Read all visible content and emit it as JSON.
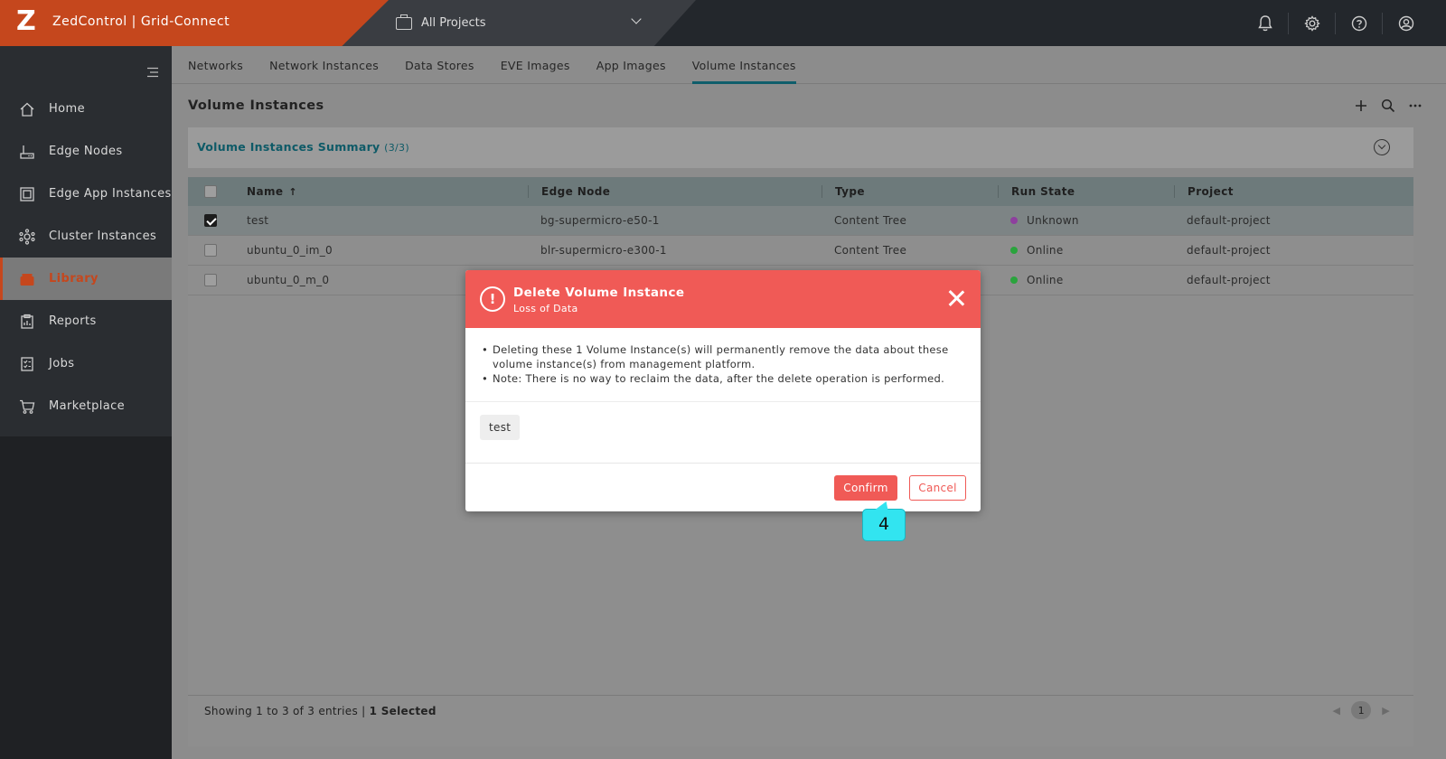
{
  "header": {
    "logo_letter": "Z",
    "app_title": "ZedControl | Grid-Connect",
    "project_selector": "All Projects",
    "icons": [
      "bell-icon",
      "gear-icon",
      "help-icon",
      "user-icon"
    ]
  },
  "sidebar": {
    "items": [
      {
        "label": "Home",
        "icon": "home-icon"
      },
      {
        "label": "Edge Nodes",
        "icon": "edge-node-icon"
      },
      {
        "label": "Edge App Instances",
        "icon": "app-instance-icon"
      },
      {
        "label": "Cluster Instances",
        "icon": "cluster-icon"
      },
      {
        "label": "Library",
        "icon": "library-icon",
        "active": true
      },
      {
        "label": "Reports",
        "icon": "reports-icon"
      },
      {
        "label": "Jobs",
        "icon": "jobs-icon"
      },
      {
        "label": "Marketplace",
        "icon": "cart-icon"
      }
    ]
  },
  "tabs": [
    {
      "label": "Networks"
    },
    {
      "label": "Network Instances"
    },
    {
      "label": "Data Stores"
    },
    {
      "label": "EVE Images"
    },
    {
      "label": "App Images"
    },
    {
      "label": "Volume Instances",
      "active": true
    }
  ],
  "page": {
    "title": "Volume Instances",
    "summary_title": "Volume Instances Summary",
    "summary_count": "(3/3)"
  },
  "table": {
    "columns": [
      "Name",
      "Edge Node",
      "Type",
      "Run State",
      "Project"
    ],
    "rows": [
      {
        "name": "test",
        "edge_node": "bg-supermicro-e50-1",
        "type": "Content Tree",
        "run_state": "Unknown",
        "state_color": "#8e3f9e",
        "project": "default-project",
        "checked": true
      },
      {
        "name": "ubuntu_0_im_0",
        "edge_node": "blr-supermicro-e300-1",
        "type": "Content Tree",
        "run_state": "Online",
        "state_color": "#2aa43d",
        "project": "default-project",
        "checked": false
      },
      {
        "name": "ubuntu_0_m_0",
        "edge_node": "",
        "type": "",
        "run_state": "Online",
        "state_color": "#2aa43d",
        "project": "default-project",
        "checked": false
      }
    ]
  },
  "footer": {
    "showing": "Showing 1 to 3 of 3 entries | ",
    "selected": "1 Selected",
    "page": "1"
  },
  "modal": {
    "title": "Delete Volume Instance",
    "subtitle": "Loss of Data",
    "alert_symbol": "!",
    "bullets": [
      "Deleting these 1 Volume Instance(s) will permanently remove the data about these volume instance(s) from management platform.",
      "Note: There is no way to reclaim the data, after the delete operation is performed."
    ],
    "chip": "test",
    "confirm_label": "Confirm",
    "cancel_label": "Cancel"
  },
  "callout": {
    "step": "4"
  },
  "colors": {
    "brand": "#c5471d",
    "danger": "#f05a56",
    "accent": "#0e5a67",
    "callout": "#32e4f0"
  }
}
